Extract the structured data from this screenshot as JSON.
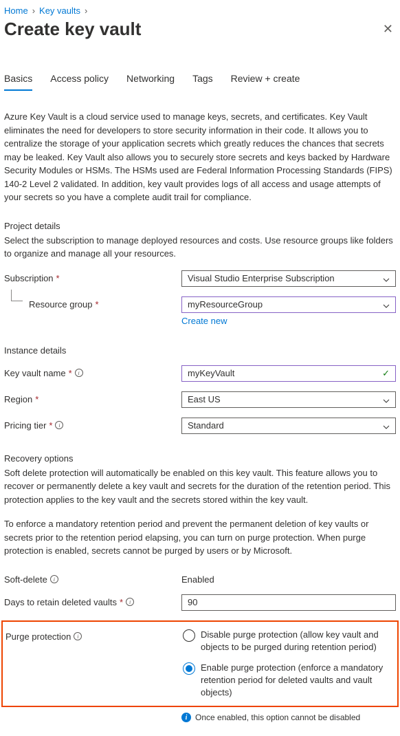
{
  "breadcrumbs": {
    "home": "Home",
    "kv": "Key vaults"
  },
  "header": {
    "title": "Create key vault"
  },
  "tabs": {
    "basics": "Basics",
    "access": "Access policy",
    "networking": "Networking",
    "tags": "Tags",
    "review": "Review + create"
  },
  "intro": "Azure Key Vault is a cloud service used to manage keys, secrets, and certificates. Key Vault eliminates the need for developers to store security information in their code. It allows you to centralize the storage of your application secrets which greatly reduces the chances that secrets may be leaked. Key Vault also allows you to securely store secrets and keys backed by Hardware Security Modules or HSMs. The HSMs used are Federal Information Processing Standards (FIPS) 140-2 Level 2 validated. In addition, key vault provides logs of all access and usage attempts of your secrets so you have a complete audit trail for compliance.",
  "project": {
    "title": "Project details",
    "desc": "Select the subscription to manage deployed resources and costs. Use resource groups like folders to organize and manage all your resources.",
    "subscription_label": "Subscription",
    "subscription_value": "Visual Studio Enterprise Subscription",
    "rg_label": "Resource group",
    "rg_value": "myResourceGroup",
    "create_new": "Create new"
  },
  "instance": {
    "title": "Instance details",
    "name_label": "Key vault name",
    "name_value": "myKeyVault",
    "region_label": "Region",
    "region_value": "East US",
    "tier_label": "Pricing tier",
    "tier_value": "Standard"
  },
  "recovery": {
    "title": "Recovery options",
    "desc1": "Soft delete protection will automatically be enabled on this key vault. This feature allows you to recover or permanently delete a key vault and secrets for the duration of the retention period. This protection applies to the key vault and the secrets stored within the key vault.",
    "desc2": "To enforce a mandatory retention period and prevent the permanent deletion of key vaults or secrets prior to the retention period elapsing, you can turn on purge protection. When purge protection is enabled, secrets cannot be purged by users or by Microsoft.",
    "soft_label": "Soft-delete",
    "soft_value": "Enabled",
    "days_label": "Days to retain deleted vaults",
    "days_value": "90",
    "purge_label": "Purge protection",
    "purge_opt1": "Disable purge protection (allow key vault and objects to be purged during retention period)",
    "purge_opt2": "Enable purge protection (enforce a mandatory retention period for deleted vaults and vault objects)",
    "note": "Once enabled, this option cannot be disabled"
  }
}
